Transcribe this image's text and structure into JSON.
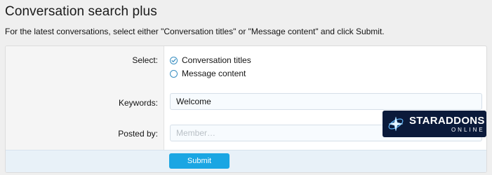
{
  "header": {
    "title": "Conversation search plus",
    "description": "For the latest conversations, select either \"Conversation titles\" or \"Message content\" and click Submit."
  },
  "form": {
    "select_label": "Select:",
    "options": [
      {
        "label": "Conversation titles",
        "checked": true
      },
      {
        "label": "Message content",
        "checked": false
      }
    ],
    "keywords_label": "Keywords:",
    "keywords_value": "Welcome",
    "posted_by_label": "Posted by:",
    "posted_by_placeholder": "Member…",
    "submit_label": "Submit"
  },
  "watermark": {
    "main_text": "STARADDONS",
    "sub_text": "ONLINE"
  },
  "colors": {
    "accent": "#1aa6e3",
    "radio_border": "#3a8fc1"
  }
}
